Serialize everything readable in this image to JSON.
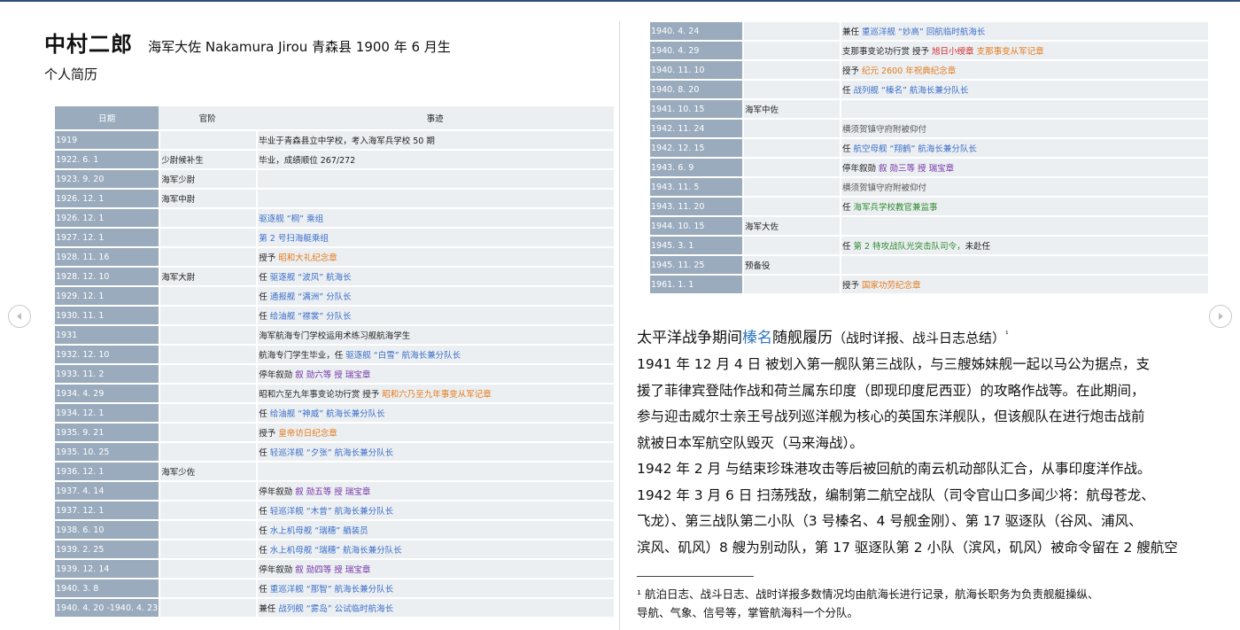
{
  "left_page": {
    "name": "中村二郎",
    "meta": "海军大佐 Nakamura Jirou 青森县 1900 年 6 月生",
    "subtitle": "个人简历",
    "headers": {
      "date": "日期",
      "rank": "官阶",
      "event": "事迹"
    }
  },
  "rows_left": [
    {
      "date": "1919",
      "rank": "",
      "event": [
        {
          "t": "毕业于青森县立中学校，考入海军兵学校 50 期"
        }
      ]
    },
    {
      "date": "1922. 6. 1",
      "rank": "少尉候补生",
      "event": [
        {
          "t": "毕业，成绩顺位 267/272"
        }
      ]
    },
    {
      "date": "1923. 9. 20",
      "rank": "海军少尉",
      "event": []
    },
    {
      "date": "1926. 12. 1",
      "rank": "海军中尉",
      "event": []
    },
    {
      "date": "1926. 12. 1",
      "rank": "",
      "event": [
        {
          "t": "驱逐舰 “桐” 乘组",
          "c": "blue"
        }
      ]
    },
    {
      "date": "1927. 12. 1",
      "rank": "",
      "event": [
        {
          "t": "第 2 号扫海艇乘组",
          "c": "blue"
        }
      ]
    },
    {
      "date": "1928. 11. 16",
      "rank": "",
      "event": [
        {
          "t": "授予 "
        },
        {
          "t": "昭和大礼纪念章",
          "c": "orange"
        }
      ]
    },
    {
      "date": "1928. 12. 10",
      "rank": "海军大尉",
      "event": [
        {
          "t": "任 "
        },
        {
          "t": "驱逐舰 “波风” 航海长",
          "c": "blue"
        }
      ]
    },
    {
      "date": "1929. 12. 1",
      "rank": "",
      "event": [
        {
          "t": "任 "
        },
        {
          "t": "通报舰 “满洲” 分队长",
          "c": "blue"
        }
      ]
    },
    {
      "date": "1930. 11. 1",
      "rank": "",
      "event": [
        {
          "t": "任 "
        },
        {
          "t": "给油舰 “襟裳” 分队长",
          "c": "blue"
        }
      ]
    },
    {
      "date": "1931",
      "rank": "",
      "event": [
        {
          "t": "海军航海专门学校运用术练习舰航海学生"
        }
      ]
    },
    {
      "date": "1932. 12. 10",
      "rank": "",
      "event": [
        {
          "t": "航海专门学生毕业，任 "
        },
        {
          "t": "驱逐舰 “白雪” 航海长兼分队长",
          "c": "blue"
        }
      ]
    },
    {
      "date": "1933. 11. 2",
      "rank": "",
      "event": [
        {
          "t": "停年叙勋 "
        },
        {
          "t": "叙 勋六等 授 瑞宝章",
          "c": "purple"
        }
      ]
    },
    {
      "date": "1934. 4. 29",
      "rank": "",
      "event": [
        {
          "t": "昭和六至九年事变论功行赏 授予 "
        },
        {
          "t": "昭和六乃至九年事变从军记章",
          "c": "orange"
        }
      ]
    },
    {
      "date": "1934. 12. 1",
      "rank": "",
      "event": [
        {
          "t": "任 "
        },
        {
          "t": "给油舰 “神威” 航海长兼分队长",
          "c": "blue"
        }
      ]
    },
    {
      "date": "1935. 9. 21",
      "rank": "",
      "event": [
        {
          "t": "授予 "
        },
        {
          "t": "皇帝访日纪念章",
          "c": "orange"
        }
      ]
    },
    {
      "date": "1935. 10. 25",
      "rank": "",
      "event": [
        {
          "t": "任 "
        },
        {
          "t": "轻巡洋舰 “夕张” 航海长兼分队长",
          "c": "blue"
        }
      ]
    },
    {
      "date": "1936. 12. 1",
      "rank": "海军少佐",
      "event": []
    },
    {
      "date": "1937. 4. 14",
      "rank": "",
      "event": [
        {
          "t": "停年叙勋 "
        },
        {
          "t": "叙 勋五等 授 瑞宝章",
          "c": "purple"
        }
      ]
    },
    {
      "date": "1937. 12. 1",
      "rank": "",
      "event": [
        {
          "t": "任 "
        },
        {
          "t": "轻巡洋舰 “木曾” 航海长兼分队长",
          "c": "blue"
        }
      ]
    },
    {
      "date": "1938. 6. 10",
      "rank": "",
      "event": [
        {
          "t": "任 "
        },
        {
          "t": "水上机母舰 “瑞穗” 舾装员",
          "c": "blue"
        }
      ]
    },
    {
      "date": "1939. 2. 25",
      "rank": "",
      "event": [
        {
          "t": "任 "
        },
        {
          "t": "水上机母舰 “瑞穗” 航海长兼分队长",
          "c": "blue"
        }
      ]
    },
    {
      "date": "1939. 12. 14",
      "rank": "",
      "event": [
        {
          "t": "停年叙勋 "
        },
        {
          "t": "叙 勋四等 授 瑞宝章",
          "c": "purple"
        }
      ]
    },
    {
      "date": "1940. 3. 8",
      "rank": "",
      "event": [
        {
          "t": "任 "
        },
        {
          "t": "重巡洋舰 “那智” 航海长兼分队长",
          "c": "blue"
        }
      ]
    },
    {
      "date": "1940. 4. 20 -1940. 4. 23",
      "rank": "",
      "event": [
        {
          "t": "兼任 "
        },
        {
          "t": "战列舰 “雾岛” 公试临时航海长",
          "c": "blue"
        }
      ]
    }
  ],
  "rows_right": [
    {
      "date": "1940. 4. 24",
      "rank": "",
      "event": [
        {
          "t": "兼任 "
        },
        {
          "t": "重巡洋舰 “妙高” 回航临时航海长",
          "c": "blue"
        }
      ]
    },
    {
      "date": "1940. 4. 29",
      "rank": "",
      "event": [
        {
          "t": "支那事变论功行赏 授予 "
        },
        {
          "t": "旭日小绶章",
          "c": "red"
        },
        {
          "t": " "
        },
        {
          "t": "支那事变从军记章",
          "c": "orange"
        }
      ]
    },
    {
      "date": "1940. 11. 10",
      "rank": "",
      "event": [
        {
          "t": "授予 "
        },
        {
          "t": "纪元 2600 年祝典纪念章",
          "c": "orange"
        }
      ]
    },
    {
      "date": "1940. 8. 20",
      "rank": "",
      "event": [
        {
          "t": "任 "
        },
        {
          "t": "战列舰 “榛名” 航海长兼分队长",
          "c": "blue"
        }
      ]
    },
    {
      "date": "1941. 10. 15",
      "rank": "海军中佐",
      "event": []
    },
    {
      "date": "1942. 11. 24",
      "rank": "",
      "event": [
        {
          "t": "横须贺镇守府附被仰付",
          "c": "grey"
        }
      ]
    },
    {
      "date": "1942. 12. 15",
      "rank": "",
      "event": [
        {
          "t": "任 "
        },
        {
          "t": "航空母舰 “翔鹤” 航海长兼分队长",
          "c": "blue"
        }
      ]
    },
    {
      "date": "1943. 6. 9",
      "rank": "",
      "event": [
        {
          "t": "停年叙勋 "
        },
        {
          "t": "叙 勋三等 授 瑞宝章",
          "c": "purple"
        }
      ]
    },
    {
      "date": "1943. 11. 5",
      "rank": "",
      "event": [
        {
          "t": "横须贺镇守府附被仰付",
          "c": "grey"
        }
      ]
    },
    {
      "date": "1943. 11. 20",
      "rank": "",
      "event": [
        {
          "t": "任 "
        },
        {
          "t": "海军兵学校教官兼监事",
          "c": "green"
        }
      ]
    },
    {
      "date": "1944. 10. 15",
      "rank": "海军大佐",
      "event": []
    },
    {
      "date": "1945. 3. 1",
      "rank": "",
      "event": [
        {
          "t": "任 "
        },
        {
          "t": "第 2 特攻战队光突击队司令，",
          "c": "green"
        },
        {
          "t": "未赴任"
        }
      ]
    },
    {
      "date": "1945. 11. 25",
      "rank": "预备役",
      "event": []
    },
    {
      "date": "1961. 1. 1",
      "rank": "",
      "event": [
        {
          "t": "授予 "
        },
        {
          "t": "国家功劳纪念章",
          "c": "orange"
        }
      ]
    }
  ],
  "article": {
    "title_pre": "太平洋战争期间",
    "title_hl": "榛名",
    "title_post": "随舰履历",
    "title_sub": "（战时详报、战斗日志总结）",
    "title_note": "¹",
    "lines": [
      "1941 年 12 月 4 日 被划入第一舰队第三战队，与三艘姊妹舰一起以马公为据点，支",
      "援了菲律宾登陆作战和荷兰属东印度（即现印度尼西亚）的攻略作战等。在此期间，",
      "参与迎击威尔士亲王号战列巡洋舰为核心的英国东洋舰队，但该舰队在进行炮击战前",
      "就被日本军航空队毁灭（马来海战）。",
      "1942 年 2 月 与结束珍珠港攻击等后被回航的南云机动部队汇合，从事印度洋作战。",
      "1942 年 3 月 6 日 扫荡残敌，编制第二航空战队（司令官山口多闻少将：航母苍龙、",
      "飞龙）、第三战队第二小队（3 号榛名、4 号舰金刚）、第 17 驱逐队（谷风、浦风、",
      "滨风、矶风）8 艘为别动队，第 17 驱逐队第 2 小队（滨风，矶风）被命令留在 2 艘航空"
    ]
  },
  "footnote": [
    "¹ 航泊日志、战斗日志、战时详报多数情况均由航海长进行记录，航海长职务为负责舰艇操纵、",
    "导航、气象、信号等，掌管航海科一个分队。"
  ]
}
